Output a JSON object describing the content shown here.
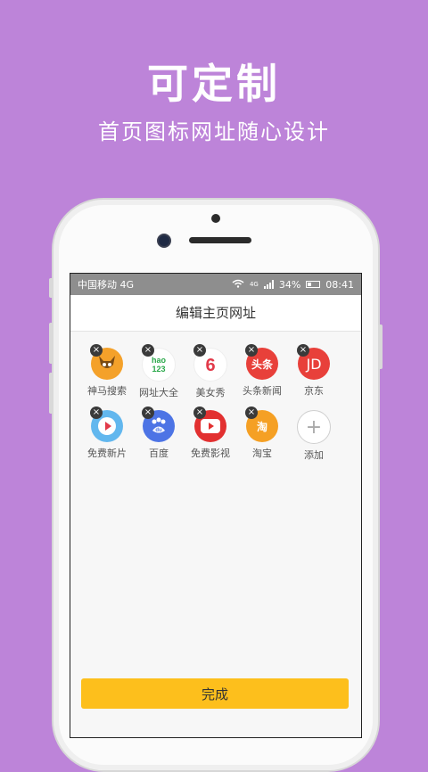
{
  "hero": {
    "title": "可定制",
    "subtitle": "首页图标网址随心设计"
  },
  "status": {
    "carrier": "中国移动 4G",
    "battery": "34%",
    "time": "08:41",
    "net_badge": "4G"
  },
  "header": {
    "title": "编辑主页网址"
  },
  "items": [
    {
      "label": "神马搜索",
      "icon": "shenma-icon",
      "glyph": "",
      "color": "#f4a12a",
      "removable": true
    },
    {
      "label": "网址大全",
      "icon": "url-directory-icon",
      "glyph": "hao\n123",
      "color": "#ffffff",
      "removable": true
    },
    {
      "label": "美女秀",
      "icon": "beauty-show-icon",
      "glyph": "6",
      "color": "#ffffff",
      "removable": true
    },
    {
      "label": "头条新闻",
      "icon": "toutiao-icon",
      "glyph": "头条",
      "color": "#e8403a",
      "removable": true
    },
    {
      "label": "京东",
      "icon": "jd-icon",
      "glyph": "JD",
      "color": "#e8403a",
      "removable": true
    },
    {
      "label": "免费新片",
      "icon": "play-blue-icon",
      "glyph": "",
      "color": "#62b7ee",
      "removable": true
    },
    {
      "label": "百度",
      "icon": "baidu-icon",
      "glyph": "du",
      "color": "#4d74e5",
      "removable": true
    },
    {
      "label": "免费影视",
      "icon": "youtube-style-play-icon",
      "glyph": "",
      "color": "#e23030",
      "removable": true
    },
    {
      "label": "淘宝",
      "icon": "taobao-icon",
      "glyph": "淘",
      "color": "#f5a024",
      "removable": true
    },
    {
      "label": "添加",
      "icon": "add-icon",
      "glyph": "+",
      "color": "#ffffff",
      "removable": false
    }
  ],
  "footer": {
    "done_label": "完成"
  },
  "remove_glyph": "×"
}
